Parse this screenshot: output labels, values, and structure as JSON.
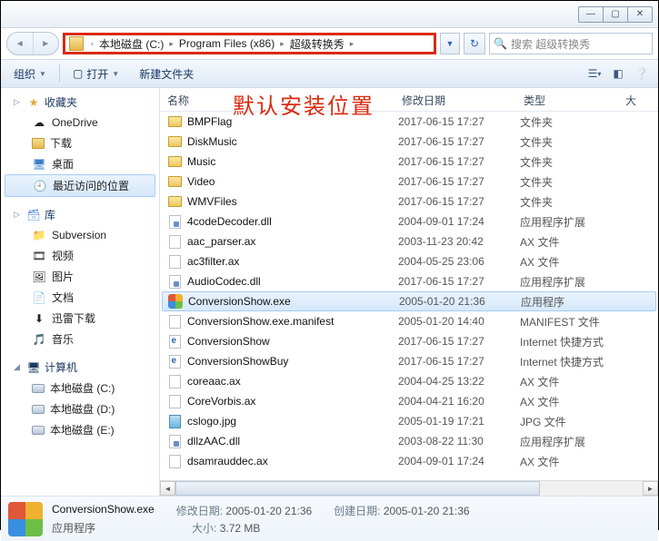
{
  "titlebar": {
    "min": "—",
    "max": "▢",
    "close": "✕"
  },
  "breadcrumb": {
    "parts": [
      "本地磁盘 (C:)",
      "Program Files (x86)",
      "超级转换秀"
    ]
  },
  "search": {
    "placeholder": "搜索 超级转换秀"
  },
  "toolbar": {
    "organize": "组织",
    "open": "打开",
    "newfolder": "新建文件夹"
  },
  "annotation": "默认安装位置",
  "columns": {
    "name": "名称",
    "date": "修改日期",
    "type": "类型",
    "size": "大"
  },
  "nav": {
    "fav": {
      "label": "收藏夹",
      "items": [
        "OneDrive",
        "下载",
        "桌面",
        "最近访问的位置"
      ]
    },
    "lib": {
      "label": "库",
      "items": [
        "Subversion",
        "视频",
        "图片",
        "文档",
        "迅雷下载",
        "音乐"
      ]
    },
    "pc": {
      "label": "计算机",
      "items": [
        "本地磁盘 (C:)",
        "本地磁盘 (D:)",
        "本地磁盘 (E:)"
      ]
    }
  },
  "files": [
    {
      "icon": "folder",
      "name": "BMPFlag",
      "date": "2017-06-15 17:27",
      "type": "文件夹"
    },
    {
      "icon": "folder",
      "name": "DiskMusic",
      "date": "2017-06-15 17:27",
      "type": "文件夹"
    },
    {
      "icon": "folder",
      "name": "Music",
      "date": "2017-06-15 17:27",
      "type": "文件夹"
    },
    {
      "icon": "folder",
      "name": "Video",
      "date": "2017-06-15 17:27",
      "type": "文件夹"
    },
    {
      "icon": "folder",
      "name": "WMVFiles",
      "date": "2017-06-15 17:27",
      "type": "文件夹"
    },
    {
      "icon": "dll",
      "name": "4codeDecoder.dll",
      "date": "2004-09-01 17:24",
      "type": "应用程序扩展"
    },
    {
      "icon": "file",
      "name": "aac_parser.ax",
      "date": "2003-11-23 20:42",
      "type": "AX 文件"
    },
    {
      "icon": "file",
      "name": "ac3filter.ax",
      "date": "2004-05-25 23:06",
      "type": "AX 文件"
    },
    {
      "icon": "dll",
      "name": "AudioCodec.dll",
      "date": "2017-06-15 17:27",
      "type": "应用程序扩展"
    },
    {
      "icon": "exe",
      "name": "ConversionShow.exe",
      "date": "2005-01-20 21:36",
      "type": "应用程序",
      "selected": true
    },
    {
      "icon": "file",
      "name": "ConversionShow.exe.manifest",
      "date": "2005-01-20 14:40",
      "type": "MANIFEST 文件"
    },
    {
      "icon": "url",
      "name": "ConversionShow",
      "date": "2017-06-15 17:27",
      "type": "Internet 快捷方式"
    },
    {
      "icon": "url",
      "name": "ConversionShowBuy",
      "date": "2017-06-15 17:27",
      "type": "Internet 快捷方式"
    },
    {
      "icon": "file",
      "name": "coreaac.ax",
      "date": "2004-04-25 13:22",
      "type": "AX 文件"
    },
    {
      "icon": "file",
      "name": "CoreVorbis.ax",
      "date": "2004-04-21 16:20",
      "type": "AX 文件"
    },
    {
      "icon": "jpg",
      "name": "cslogo.jpg",
      "date": "2005-01-19 17:21",
      "type": "JPG 文件"
    },
    {
      "icon": "dll",
      "name": "dllzAAC.dll",
      "date": "2003-08-22 11:30",
      "type": "应用程序扩展"
    },
    {
      "icon": "file",
      "name": "dsamrauddec.ax",
      "date": "2004-09-01 17:24",
      "type": "AX 文件"
    }
  ],
  "details": {
    "name": "ConversionShow.exe",
    "type": "应用程序",
    "mod_label": "修改日期:",
    "mod_value": "2005-01-20 21:36",
    "size_label": "大小:",
    "size_value": "3.72 MB",
    "created_label": "创建日期:",
    "created_value": "2005-01-20 21:36"
  }
}
